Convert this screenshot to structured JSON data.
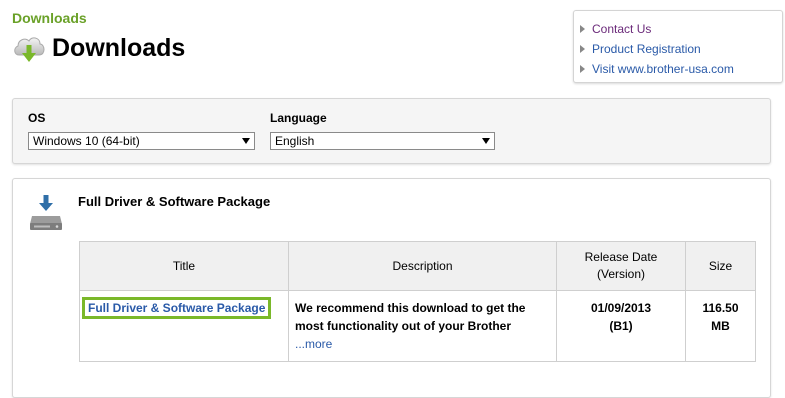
{
  "breadcrumb": "Downloads",
  "page_title": "Downloads",
  "quick_links": [
    {
      "label": "Contact Us",
      "visited": true
    },
    {
      "label": "Product Registration",
      "visited": false
    },
    {
      "label": "Visit www.brother-usa.com",
      "visited": false
    }
  ],
  "filters": {
    "os": {
      "label": "OS",
      "selected": "Windows 10 (64-bit)"
    },
    "language": {
      "label": "Language",
      "selected": "English"
    }
  },
  "package": {
    "heading": "Full Driver & Software Package",
    "table": {
      "headers": {
        "title": "Title",
        "description": "Description",
        "release_date": "Release Date",
        "release_version": "(Version)",
        "size": "Size"
      },
      "row": {
        "title": "Full Driver & Software Package",
        "description_line1": "We recommend this download to get the",
        "description_line2": "most functionality out of your Brother",
        "more": "...more",
        "date": "01/09/2013",
        "version": "(B1)",
        "size_value": "116.50",
        "size_unit": "MB"
      }
    }
  },
  "colors": {
    "accent_green": "#6aa128",
    "link_blue": "#2a5aa8",
    "visited_purple": "#6b2a7a",
    "highlight_green": "#7ab82a"
  },
  "icons": {
    "title": "cloud-download-icon",
    "package": "download-drive-icon",
    "link_arrow": "triangle-right-icon",
    "select": "chevron-down-icon"
  }
}
